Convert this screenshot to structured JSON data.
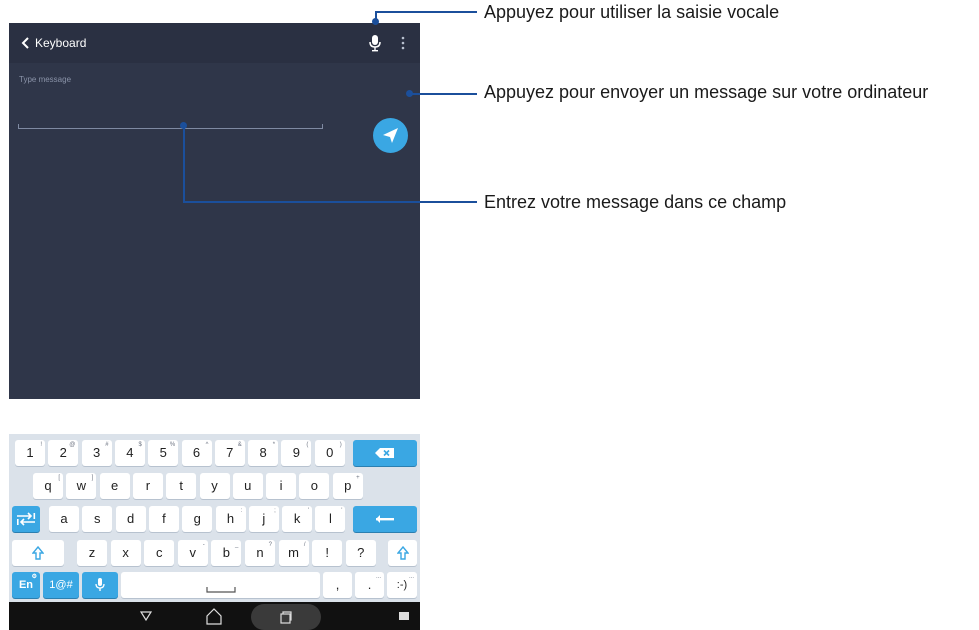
{
  "app_bar": {
    "title": "Keyboard"
  },
  "message": {
    "placeholder": "Type message"
  },
  "keyboard": {
    "rows": [
      [
        {
          "label": "1",
          "sup": "!"
        },
        {
          "label": "2",
          "sup": "@"
        },
        {
          "label": "3",
          "sup": "#"
        },
        {
          "label": "4",
          "sup": "$"
        },
        {
          "label": "5",
          "sup": "%"
        },
        {
          "label": "6",
          "sup": "^"
        },
        {
          "label": "7",
          "sup": "&"
        },
        {
          "label": "8",
          "sup": "*"
        },
        {
          "label": "9",
          "sup": "("
        },
        {
          "label": "0",
          "sup": ")"
        }
      ],
      [
        {
          "label": "q",
          "sup": "["
        },
        {
          "label": "w",
          "sup": "]"
        },
        {
          "label": "e",
          "sup": ""
        },
        {
          "label": "r",
          "sup": ""
        },
        {
          "label": "t",
          "sup": ""
        },
        {
          "label": "y",
          "sup": ""
        },
        {
          "label": "u",
          "sup": ""
        },
        {
          "label": "i",
          "sup": ""
        },
        {
          "label": "o",
          "sup": ""
        },
        {
          "label": "p",
          "sup": "+"
        }
      ],
      [
        {
          "label": "a",
          "sup": ""
        },
        {
          "label": "s",
          "sup": ""
        },
        {
          "label": "d",
          "sup": ""
        },
        {
          "label": "f",
          "sup": ""
        },
        {
          "label": "g",
          "sup": ""
        },
        {
          "label": "h",
          "sup": ":"
        },
        {
          "label": "j",
          "sup": ";"
        },
        {
          "label": "k",
          "sup": "'"
        },
        {
          "label": "l",
          "sup": "'"
        }
      ],
      [
        {
          "label": "z",
          "sup": ""
        },
        {
          "label": "x",
          "sup": ""
        },
        {
          "label": "c",
          "sup": ""
        },
        {
          "label": "v",
          "sup": "-"
        },
        {
          "label": "b",
          "sup": "_"
        },
        {
          "label": "n",
          "sup": "?"
        },
        {
          "label": "m",
          "sup": "/"
        },
        {
          "label": "!",
          "sup": ""
        },
        {
          "label": "?",
          "sup": ""
        }
      ]
    ],
    "bottom": {
      "lang": "En",
      "symbols": "1@#",
      "comma": ",",
      "period": ".",
      "period_sup": "...",
      "smiley": ":-)",
      "smiley_sup": "..."
    }
  },
  "callouts": {
    "voice": "Appuyez pour utiliser la saisie vocale",
    "send": "Appuyez pour envoyer un message sur votre ordinateur",
    "field": "Entrez votre message dans ce champ"
  },
  "colors": {
    "accent": "#3aa7e3",
    "callout_line": "#1b4f9b",
    "screen_bg": "#2f3649"
  }
}
